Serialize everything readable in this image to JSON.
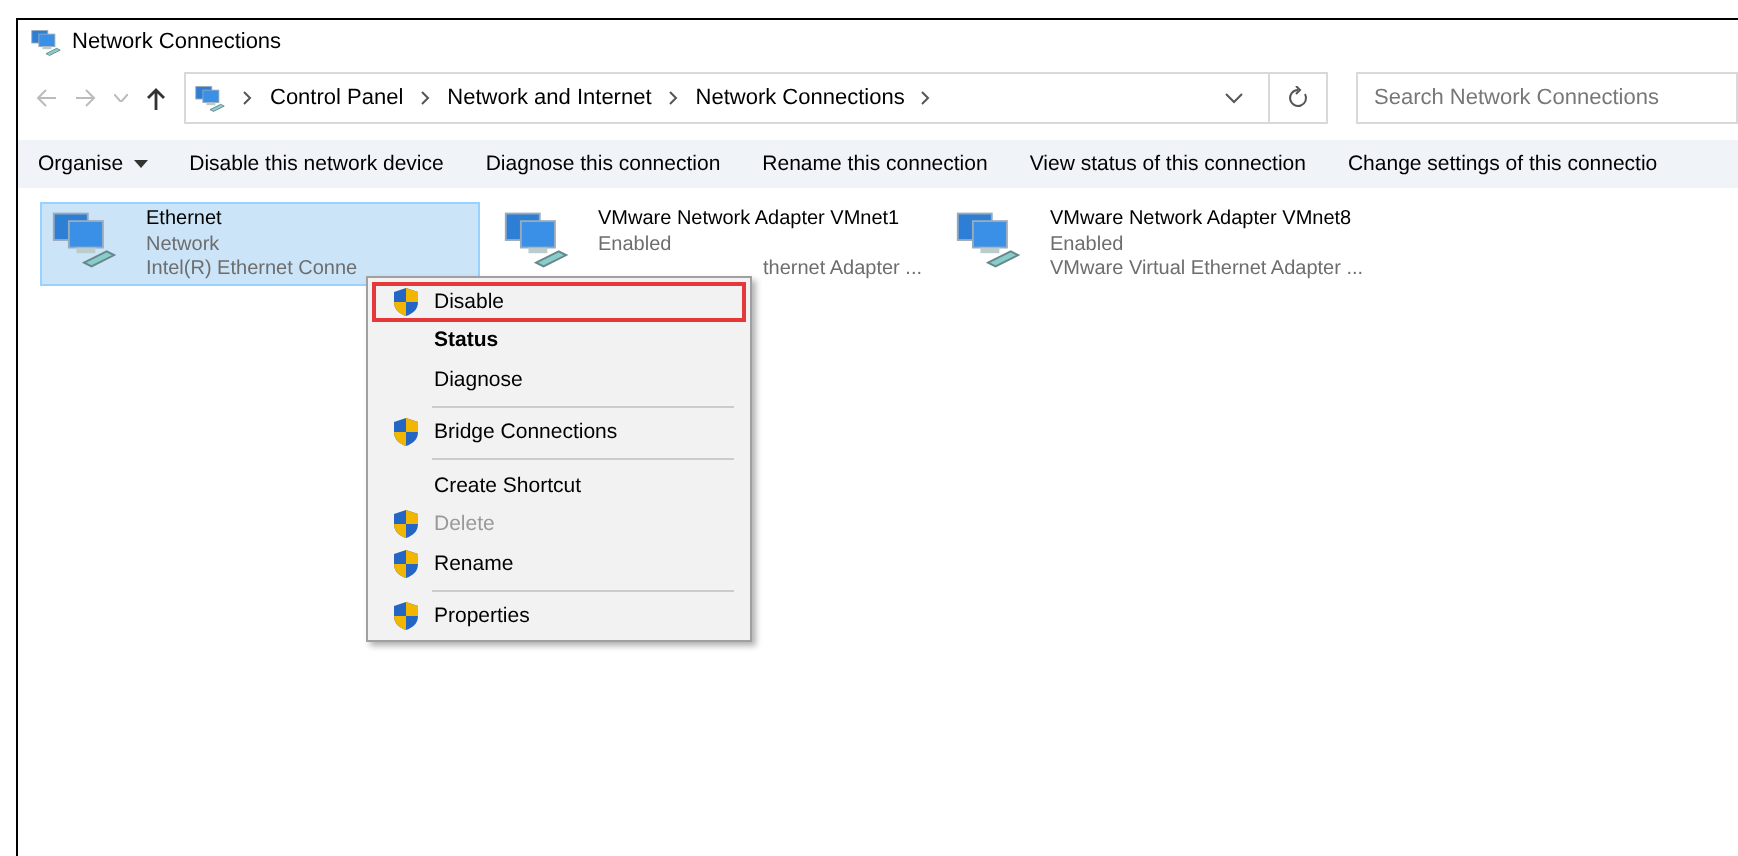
{
  "window": {
    "title": "Network Connections"
  },
  "address_bar": {
    "crumbs": [
      "Control Panel",
      "Network and Internet",
      "Network Connections"
    ]
  },
  "search": {
    "placeholder": "Search Network Connections"
  },
  "toolbar": [
    "Organise",
    "Disable this network device",
    "Diagnose this connection",
    "Rename this connection",
    "View status of this connection",
    "Change settings of this connectio"
  ],
  "adapters": [
    {
      "name": "Ethernet",
      "status": "Network",
      "device": "Intel(R) Ethernet Conne",
      "device_covered": false,
      "selected": true
    },
    {
      "name": "VMware Network Adapter VMnet1",
      "status": "Enabled",
      "device": "thernet Adapter ...",
      "device_covered": true,
      "selected": false
    },
    {
      "name": "VMware Network Adapter VMnet8",
      "status": "Enabled",
      "device": "VMware Virtual Ethernet Adapter ...",
      "device_covered": false,
      "selected": false
    }
  ],
  "context_menu": [
    {
      "kind": "item",
      "label": "Disable",
      "shield": true,
      "bold": false,
      "disabled": false,
      "selected": true
    },
    {
      "kind": "item",
      "label": "Status",
      "shield": false,
      "bold": true,
      "disabled": false,
      "selected": false
    },
    {
      "kind": "item",
      "label": "Diagnose",
      "shield": false,
      "bold": false,
      "disabled": false,
      "selected": false
    },
    {
      "kind": "separator"
    },
    {
      "kind": "item",
      "label": "Bridge Connections",
      "shield": true,
      "bold": false,
      "disabled": false,
      "selected": false
    },
    {
      "kind": "separator"
    },
    {
      "kind": "item",
      "label": "Create Shortcut",
      "shield": false,
      "bold": false,
      "disabled": false,
      "selected": false
    },
    {
      "kind": "item",
      "label": "Delete",
      "shield": true,
      "bold": false,
      "disabled": true,
      "selected": false
    },
    {
      "kind": "item",
      "label": "Rename",
      "shield": true,
      "bold": false,
      "disabled": false,
      "selected": false
    },
    {
      "kind": "separator"
    },
    {
      "kind": "item",
      "label": "Properties",
      "shield": true,
      "bold": false,
      "disabled": false,
      "selected": false
    }
  ]
}
